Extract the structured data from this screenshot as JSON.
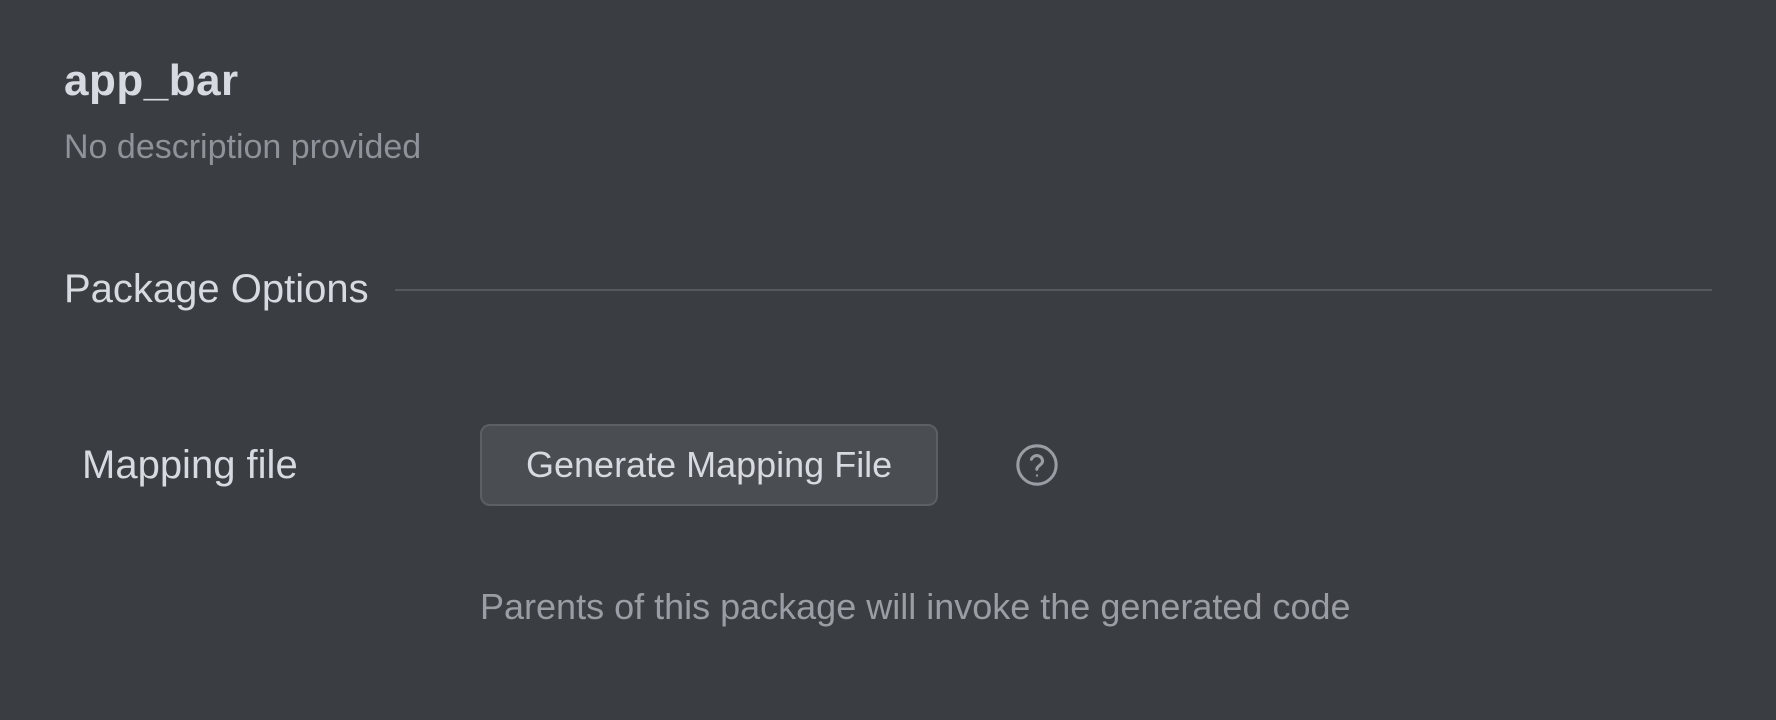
{
  "header": {
    "title": "app_bar",
    "description": "No description provided"
  },
  "section": {
    "title": "Package Options"
  },
  "options": {
    "mapping_file": {
      "label": "Mapping file",
      "button_label": "Generate Mapping File",
      "help_text": "Parents of this package will invoke the generated code"
    }
  }
}
